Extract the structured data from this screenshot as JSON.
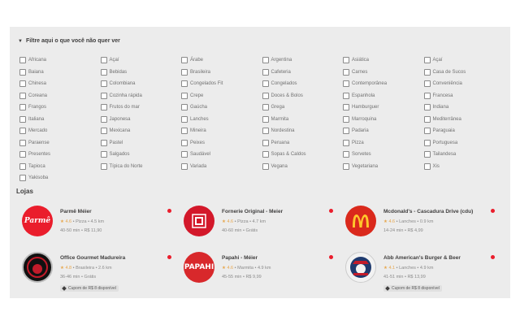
{
  "filter": {
    "title": "Filtre aqui o que você não quer ver",
    "options": [
      "Africana",
      "Açaí",
      "Árabe",
      "Argentina",
      "Asiática",
      "Açaí",
      "Baiana",
      "Bebidas",
      "Brasileira",
      "Cafeteria",
      "Carnes",
      "Casa de Sucos",
      "Chinesa",
      "Colombiana",
      "Congelados Fit",
      "Congelados",
      "Contemporânea",
      "Conveniência",
      "Coreana",
      "Cozinha rápida",
      "Crepe",
      "Doces & Bolos",
      "Espanhola",
      "Francesa",
      "Frangos",
      "Frutos do mar",
      "Gaúcha",
      "Grega",
      "Hamburguer",
      "Indiana",
      "Italiana",
      "Japonesa",
      "Lanches",
      "Marmita",
      "Marroquina",
      "Mediterrânea",
      "Mercado",
      "Mexicana",
      "Mineira",
      "Nordestina",
      "Padaria",
      "Paraguaia",
      "Paraense",
      "Pastel",
      "Peixes",
      "Peruana",
      "Pizza",
      "Portuguesa",
      "Presentes",
      "Salgados",
      "Saudável",
      "Sopas & Caldos",
      "Sorvetes",
      "Tailandesa",
      "Tapioca",
      "Típica do Norte",
      "Variada",
      "Vegana",
      "Vegetariana",
      "Xis",
      "Yakisoba"
    ]
  },
  "stores_section": {
    "title": "Lojas",
    "stores": [
      {
        "name": "Parmê Méier",
        "rating": "4.6",
        "category": "Pizza",
        "distance": "4.5 km",
        "time": "40-50 min",
        "fee": "R$ 11,90",
        "coupon": "",
        "logo_text": "Parmê",
        "logo_color": "#ea1d2c"
      },
      {
        "name": "Fornerie Original - Meier",
        "rating": "4.6",
        "category": "Pizza",
        "distance": "4.7 km",
        "time": "40-60 min",
        "fee": "Grátis",
        "coupon": "",
        "logo_text": "",
        "logo_color": "#d3182a"
      },
      {
        "name": "Mcdonald's - Cascadura Drive (cdu)",
        "rating": "4.6",
        "category": "Lanches",
        "distance": "0.9 km",
        "time": "14-24 min",
        "fee": "R$ 4,99",
        "coupon": "",
        "logo_text": "M",
        "logo_color": "#da291c"
      },
      {
        "name": "Office Gourmet Madureira",
        "rating": "4.8",
        "category": "Brasileira",
        "distance": "2.6 km",
        "time": "36-46 min",
        "fee": "Grátis",
        "coupon": "Cupom de R$ 8 disponível",
        "logo_text": "OFFICE",
        "logo_color": "#111111"
      },
      {
        "name": "Papahi - Méier",
        "rating": "4.6",
        "category": "Marmita",
        "distance": "4.9 km",
        "time": "45-55 min",
        "fee": "R$ 9,99",
        "coupon": "",
        "logo_text": "PAPAHI",
        "logo_color": "#d8282b"
      },
      {
        "name": "Abb American's Burger & Beer",
        "rating": "4.1",
        "category": "Lanches",
        "distance": "4.9 km",
        "time": "41-51 min",
        "fee": "R$ 13,99",
        "coupon": "Cupom de R$ 8 disponível",
        "logo_text": "",
        "logo_color": "#f2f2f2"
      }
    ]
  },
  "colors": {
    "accent": "#ea1d2c",
    "star": "#e7a74e",
    "text": "#3f3e3e",
    "muted": "#8a8a8a",
    "panel": "#ececec"
  }
}
